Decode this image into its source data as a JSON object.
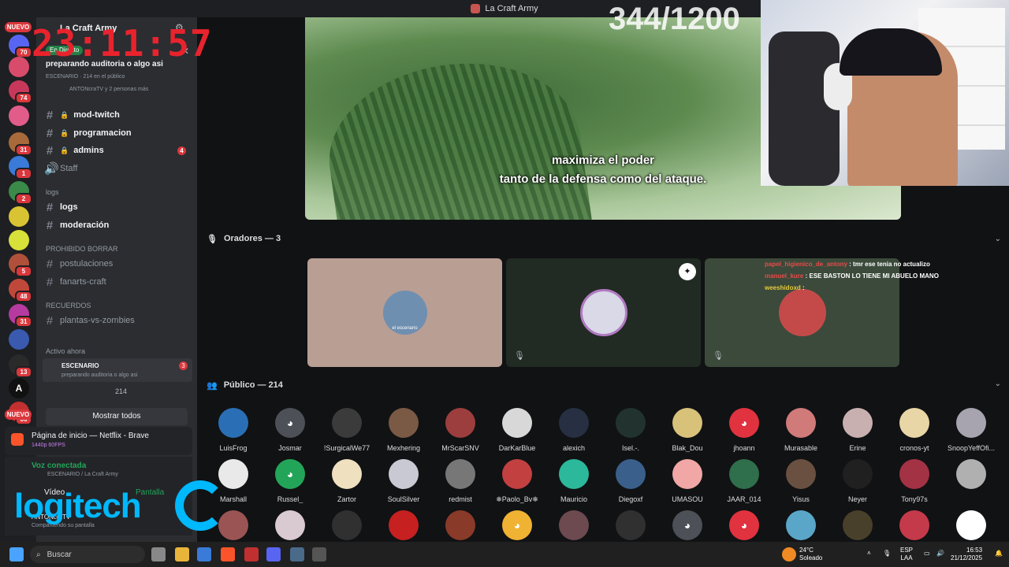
{
  "window": {
    "title": "La Craft Army"
  },
  "overlay": {
    "clock": "23:11:57",
    "counter": "344/1200"
  },
  "server_rail": {
    "nuevo_top": "NUEVO",
    "nuevo_bottom": "NUEVO",
    "badges": [
      "70",
      "74",
      "31",
      "1",
      "2",
      "5",
      "48",
      "31",
      "5",
      "13",
      "66",
      "83"
    ]
  },
  "sidebar": {
    "server_name": "La Craft Army",
    "stage": {
      "live_label": "En Directo",
      "title": "preparando auditoria o algo asi",
      "location": "ESCENARIO",
      "audience": "214 en el público",
      "speakers": "ANTONcraTV y 2 personas más"
    },
    "channels": [
      {
        "name": "mod-twitch",
        "bright": true,
        "locked": true,
        "badge": ""
      },
      {
        "name": "programacion",
        "bright": true,
        "locked": true,
        "badge": ""
      },
      {
        "name": "admins",
        "bright": true,
        "locked": true,
        "badge": "4"
      },
      {
        "name": "Staff",
        "bright": false,
        "voice": true,
        "badge": ""
      }
    ],
    "cat_logs": "logs",
    "logs_channels": [
      {
        "name": "logs",
        "bright": true
      },
      {
        "name": "moderación",
        "bright": true
      }
    ],
    "cat_prohibido": "PROHIBIDO BORRAR",
    "prohibido_channels": [
      {
        "name": "postulaciones"
      },
      {
        "name": "fanarts-craft"
      }
    ],
    "cat_recuerdos": "RECUERDOS",
    "recuerdos_channels": [
      {
        "name": "plantas-vs-zombies"
      }
    ],
    "active_now": {
      "heading": "Activo ahora",
      "stage_name": "ESCENARIO",
      "stage_badge": "3",
      "stage_topic": "preparando auditoria o algo asi",
      "count": "214",
      "show_all": "Mostrar todos"
    },
    "notification": {
      "title": "Página de inicio — Netflix - Brave",
      "subtitle": "1440p 60FPS"
    },
    "voice": {
      "status": "Voz conectada",
      "location": "ESCENARIO / La Craft Army",
      "video_label": "Vídeo",
      "screen_label": "Pantalla",
      "user_name": "ANTONcraTV",
      "user_status": "Compartiendo su pantalla"
    },
    "logitech": "logitech"
  },
  "stream": {
    "subtitle_line1": "maximiza el poder",
    "subtitle_line2": "tanto de la defensa como del ataque."
  },
  "speakers": {
    "heading": "Oradores — 3",
    "avatar_caption": "el escenario",
    "chat": [
      {
        "user": "papel_higienico_de_antony",
        "msg": ": tmr ese tenia no actualizo"
      },
      {
        "user": "manuel_kure",
        "msg": ": ESE BASTON LO TIENE MI ABUELO MANO"
      },
      {
        "user": "weeshidoxd",
        "msg": ":"
      }
    ]
  },
  "audience": {
    "heading": "Público — 214",
    "row1": [
      "LuisFrog",
      "Josmar",
      "!SurgicalWe77",
      "Mexhering",
      "MrScarSNV",
      "DarKarBlue",
      "alexich",
      "Isel.-.",
      "Blak_Dou",
      "jhoann",
      "Murasable",
      "Erine",
      "cronos-yt",
      "SnoopYeffOfi..."
    ],
    "row2": [
      "Marshall",
      "Russel_",
      "Zartor",
      "SoulSilver",
      "redmist",
      "❄Paolo_Bv❄",
      "Mauricio",
      "Diegoxf",
      "UMASOU",
      "JAAR_014",
      "Yisus",
      "Neyer",
      "Tony97s",
      ""
    ],
    "colors1": [
      "#2a6fb5",
      "#4e5058",
      "#3b3b3b",
      "#7a5a45",
      "#9c3e3e",
      "#d8d8d8",
      "#263042",
      "#22332f",
      "#d8c27a",
      "#e0333f",
      "#d07a7a",
      "#c9b0b0",
      "#e8d6a6",
      "#a7a4b0"
    ],
    "colors2": [
      "#e9e9e9",
      "#23a559",
      "#efe0bf",
      "#c9c9d4",
      "#777777",
      "#c24040",
      "#2cb89a",
      "#3a5f8a",
      "#f0a7a5",
      "#2f6f4b",
      "#6a5040",
      "#202020",
      "#a33244",
      "#b0b0b0"
    ],
    "colors3": [
      "#9a5454",
      "#d9c9d0",
      "#303030",
      "#c62020",
      "#8a3a28",
      "#f0b232",
      "#6c4a50",
      "#303030",
      "#4e5058",
      "#e0333f",
      "#5aa6c8",
      "#48402a",
      "#c43a4a",
      "#ffffff"
    ]
  },
  "taskbar": {
    "search": "Buscar",
    "weather_temp": "24°C",
    "weather_desc": "Soleado",
    "lang_1": "ESP",
    "lang_2": "LAA",
    "time": "16:53",
    "date": "21/12/2025"
  }
}
